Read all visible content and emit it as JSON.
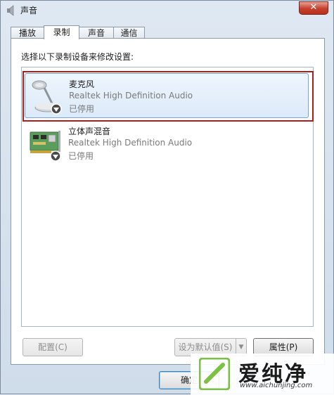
{
  "window": {
    "title": "声音",
    "close_label": "✕"
  },
  "tabs": [
    {
      "label": "播放"
    },
    {
      "label": "录制"
    },
    {
      "label": "声音"
    },
    {
      "label": "通信"
    }
  ],
  "active_tab": "录制",
  "instruction": "选择以下录制设备来修改设置:",
  "devices": [
    {
      "name": "麦克风",
      "driver": "Realtek High Definition Audio",
      "status": "已停用",
      "selected": true
    },
    {
      "name": "立体声混音",
      "driver": "Realtek High Definition Audio",
      "status": "已停用",
      "selected": false
    }
  ],
  "buttons": {
    "configure": "配置(C)",
    "set_default": "设为默认值(S)",
    "properties": "属性(P)",
    "ok": "确定"
  },
  "watermark": {
    "text": "爱纯净",
    "url": "www.aichunjing.com"
  },
  "colors": {
    "highlight_frame": "#b01c1c",
    "selection": "#dbeaf9",
    "close_button": "#c5402c"
  }
}
